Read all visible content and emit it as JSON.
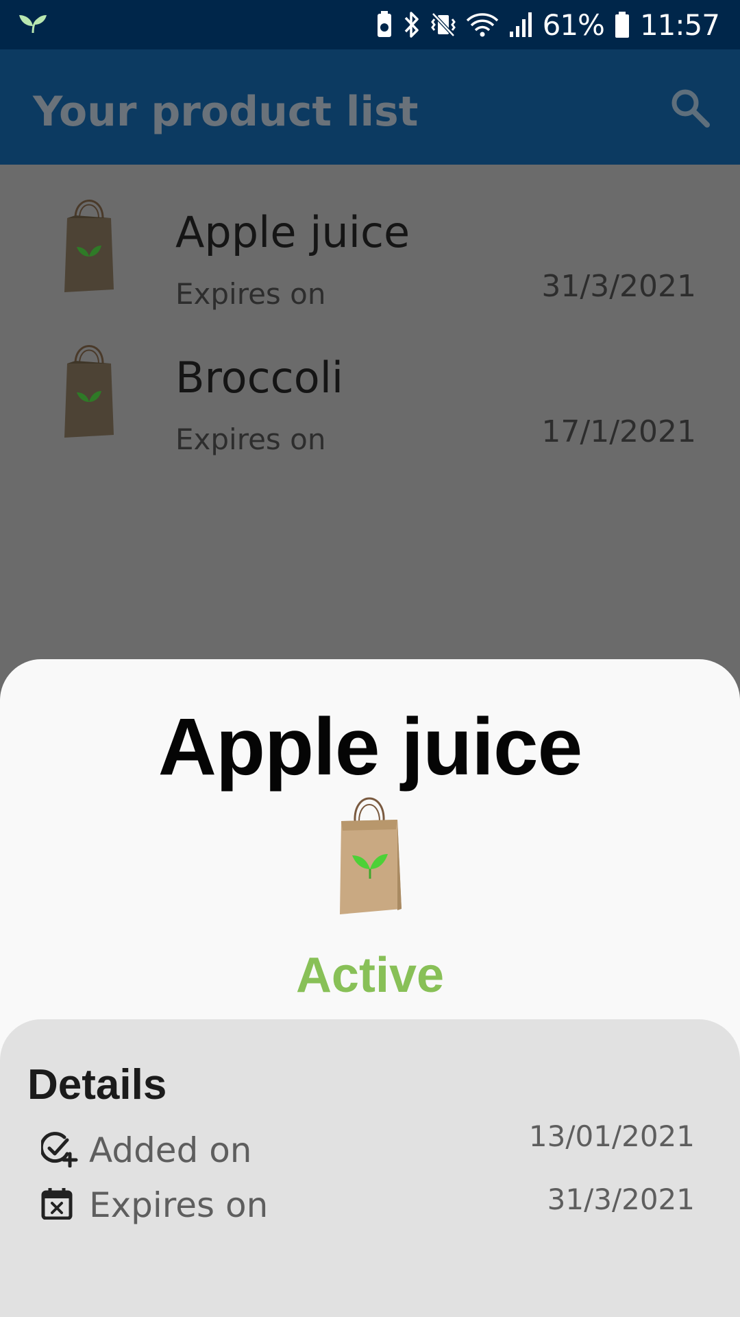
{
  "status_bar": {
    "battery": "61%",
    "time": "11:57",
    "icons": [
      "leaf-icon",
      "battery-saver-icon",
      "bluetooth-icon",
      "vibrate-icon",
      "wifi-icon",
      "signal-icon",
      "battery-icon"
    ]
  },
  "app_bar": {
    "title": "Your product list",
    "search_icon": "search-icon"
  },
  "products": [
    {
      "name": "Apple juice",
      "subtitle": "Expires on",
      "date": "31/3/2021",
      "icon": "shopping-bag-icon"
    },
    {
      "name": "Broccoli",
      "subtitle": "Expires on",
      "date": "17/1/2021",
      "icon": "shopping-bag-icon"
    }
  ],
  "sheet": {
    "title": "Apple juice",
    "icon": "shopping-bag-icon",
    "status": "Active",
    "status_color": "#88c057",
    "details": {
      "title": "Details",
      "rows": [
        {
          "icon": "check-add-icon",
          "label": "Added on",
          "value": "13/01/2021"
        },
        {
          "icon": "calendar-x-icon",
          "label": "Expires on",
          "value": "31/3/2021"
        }
      ]
    }
  },
  "colors": {
    "status_bar": "#00264a",
    "app_bar": "#0c3a61",
    "scrim": "#6b6b6b",
    "sheet": "#f9f9f9",
    "details_bg": "#e1e1e1",
    "leaf_green": "#4cd137"
  }
}
